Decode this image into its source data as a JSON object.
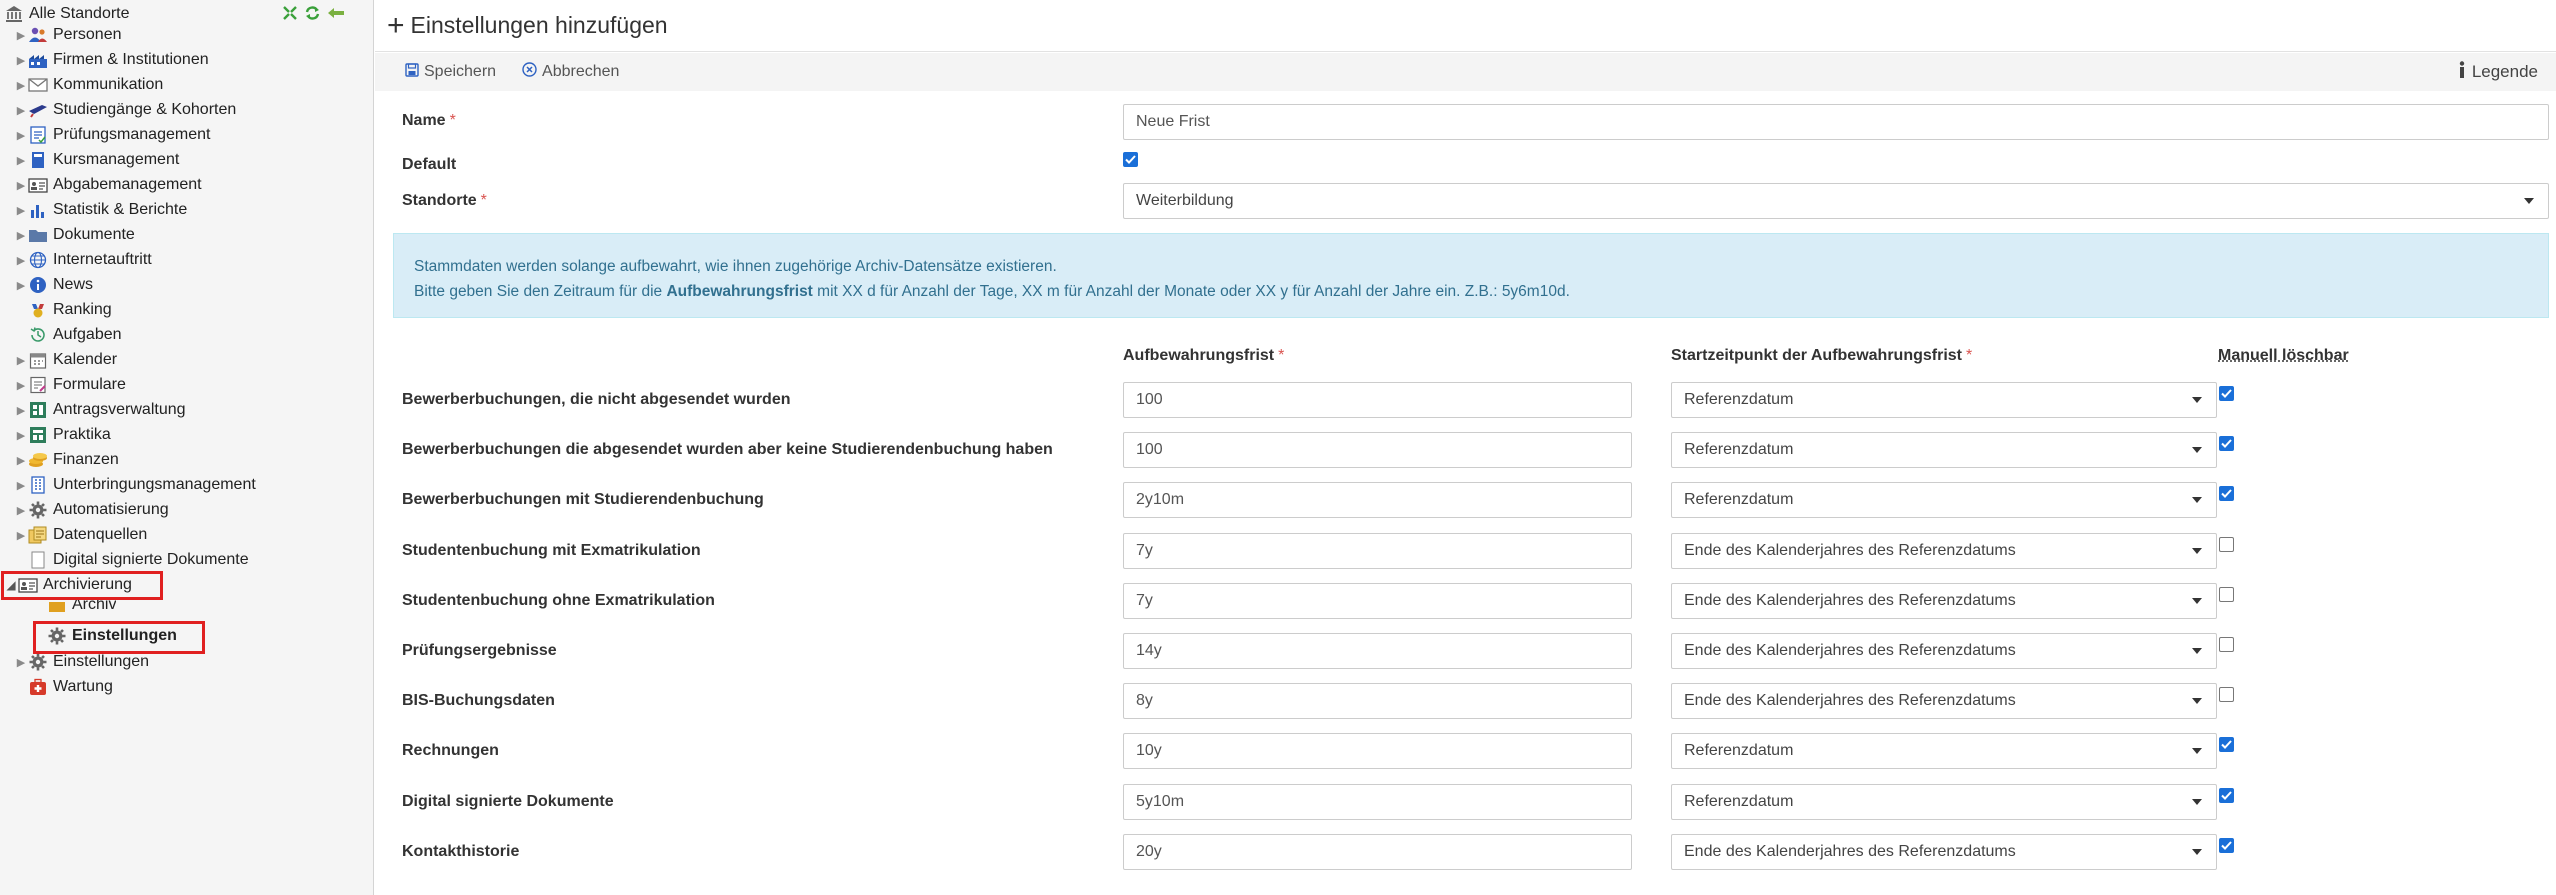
{
  "sidebar": {
    "root_label": "Alle Standorte",
    "items": [
      {
        "label": "Personen",
        "icon": "people-icon"
      },
      {
        "label": "Firmen & Institutionen",
        "icon": "factory-icon"
      },
      {
        "label": "Kommunikation",
        "icon": "envelope-icon"
      },
      {
        "label": "Studiengänge & Kohorten",
        "icon": "graduation-cap-icon"
      },
      {
        "label": "Prüfungsmanagement",
        "icon": "exam-sheet-icon"
      },
      {
        "label": "Kursmanagement",
        "icon": "book-icon"
      },
      {
        "label": "Abgabemanagement",
        "icon": "id-card-icon"
      },
      {
        "label": "Statistik & Berichte",
        "icon": "bar-chart-icon"
      },
      {
        "label": "Dokumente",
        "icon": "folder-icon"
      },
      {
        "label": "Internetauftritt",
        "icon": "globe-icon"
      },
      {
        "label": "News",
        "icon": "info-icon"
      },
      {
        "label": "Ranking",
        "icon": "ranking-icon"
      },
      {
        "label": "Aufgaben",
        "icon": "history-clock-icon"
      },
      {
        "label": "Kalender",
        "icon": "calendar-icon"
      },
      {
        "label": "Formulare",
        "icon": "form-icon"
      },
      {
        "label": "Antragsverwaltung",
        "icon": "request-icon"
      },
      {
        "label": "Praktika",
        "icon": "internship-icon"
      },
      {
        "label": "Finanzen",
        "icon": "coins-icon"
      },
      {
        "label": "Unterbringungsmanagement",
        "icon": "building-icon"
      },
      {
        "label": "Automatisierung",
        "icon": "gear-icon"
      },
      {
        "label": "Datenquellen",
        "icon": "database-icon"
      },
      {
        "label": "Digital signierte Dokumente",
        "icon": "signed-document-icon"
      },
      {
        "label": "Archivierung",
        "icon": "archive-icon"
      },
      {
        "label": "Archiv",
        "icon": "archive-box-icon"
      },
      {
        "label": "Einstellungen",
        "icon": "gear-icon"
      },
      {
        "label": "Einstellungen",
        "icon": "gear-icon"
      },
      {
        "label": "Wartung",
        "icon": "first-aid-icon"
      }
    ]
  },
  "header": {
    "title": "Einstellungen hinzufügen"
  },
  "toolbar": {
    "save_label": "Speichern",
    "cancel_label": "Abbrechen",
    "legend_label": "Legende"
  },
  "form": {
    "name_label": "Name",
    "name_value": "Neue Frist",
    "default_label": "Default",
    "default_checked": true,
    "standorte_label": "Standorte",
    "standorte_value": "Weiterbildung",
    "required_marker": "*"
  },
  "info": {
    "line1": "Stammdaten werden solange aufbewahrt, wie ihnen zugehörige Archiv-Datensätze existieren.",
    "line2_pre": "Bitte geben Sie den Zeitraum für die ",
    "line2_bold": "Aufbewahrungsfrist",
    "line2_post": " mit XX d für Anzahl der Tage, XX m für Anzahl der Monate oder XX y für Anzahl der Jahre ein. Z.B.: 5y6m10d."
  },
  "table": {
    "col_retention": "Aufbewahrungsfrist",
    "col_start": "Startzeitpunkt der Aufbewahrungsfrist",
    "col_manual": "Manuell löschbar",
    "rows": [
      {
        "label": "Bewerberbuchungen, die nicht abgesendet wurden",
        "retention": "100",
        "start": "Referenzdatum",
        "manual": true
      },
      {
        "label": "Bewerberbuchungen die abgesendet wurden aber keine Studierendenbuchung haben",
        "retention": "100",
        "start": "Referenzdatum",
        "manual": true
      },
      {
        "label": "Bewerberbuchungen mit Studierendenbuchung",
        "retention": "2y10m",
        "start": "Referenzdatum",
        "manual": true
      },
      {
        "label": "Studentenbuchung mit Exmatrikulation",
        "retention": "7y",
        "start": "Ende des Kalenderjahres des Referenzdatums",
        "manual": false
      },
      {
        "label": "Studentenbuchung ohne Exmatrikulation",
        "retention": "7y",
        "start": "Ende des Kalenderjahres des Referenzdatums",
        "manual": false
      },
      {
        "label": "Prüfungsergebnisse",
        "retention": "14y",
        "start": "Ende des Kalenderjahres des Referenzdatums",
        "manual": false
      },
      {
        "label": "BIS-Buchungsdaten",
        "retention": "8y",
        "start": "Ende des Kalenderjahres des Referenzdatums",
        "manual": false
      },
      {
        "label": "Rechnungen",
        "retention": "10y",
        "start": "Referenzdatum",
        "manual": true
      },
      {
        "label": "Digital signierte Dokumente",
        "retention": "5y10m",
        "start": "Referenzdatum",
        "manual": true
      },
      {
        "label": "Kontakthistorie",
        "retention": "20y",
        "start": "Ende des Kalenderjahres des Referenzdatums",
        "manual": true
      }
    ]
  },
  "colors": {
    "accent": "#1a6fd8",
    "highlight": "#e02020",
    "info_bg": "#d9edf7",
    "info_text": "#31708f",
    "required": "#d9534f"
  }
}
